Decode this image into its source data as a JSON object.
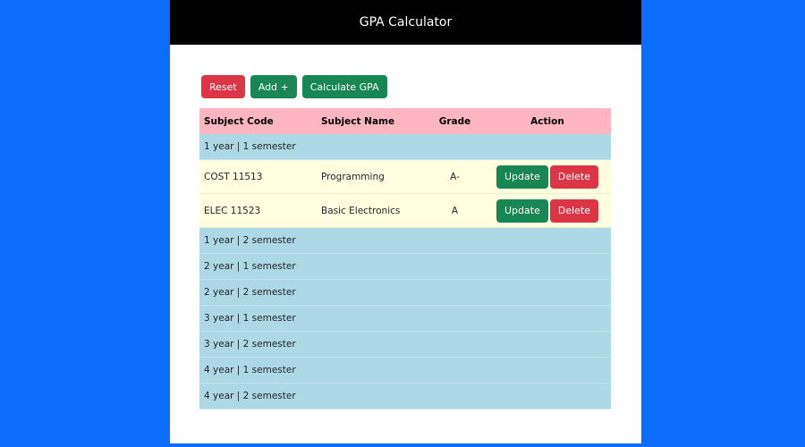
{
  "header": {
    "title": "GPA Calculator"
  },
  "toolbar": {
    "reset_label": "Reset",
    "add_label": "Add +",
    "calculate_label": "Calculate GPA"
  },
  "table": {
    "columns": [
      "Subject Code",
      "Subject Name",
      "Grade",
      "Action"
    ],
    "update_label": "Update",
    "delete_label": "Delete",
    "semesters": [
      {
        "label": "1 year | 1 semester",
        "subjects": [
          {
            "code": "COST 11513",
            "name": "Programming",
            "grade": "A-"
          },
          {
            "code": "ELEC 11523",
            "name": "Basic Electronics",
            "grade": "A"
          }
        ]
      },
      {
        "label": "1 year | 2 semester",
        "subjects": []
      },
      {
        "label": "2 year | 1 semester",
        "subjects": []
      },
      {
        "label": "2 year | 2 semester",
        "subjects": []
      },
      {
        "label": "3 year | 1 semester",
        "subjects": []
      },
      {
        "label": "3 year | 2 semester",
        "subjects": []
      },
      {
        "label": "4 year | 1 semester",
        "subjects": []
      },
      {
        "label": "4 year | 2 semester",
        "subjects": []
      }
    ]
  },
  "colors": {
    "background": "#0d6efd",
    "header": "#000000",
    "danger": "#dc3545",
    "success": "#198754",
    "table_head": "#ffb6c1",
    "semester_row": "#add8e6",
    "subject_row": "#ffffe0"
  }
}
